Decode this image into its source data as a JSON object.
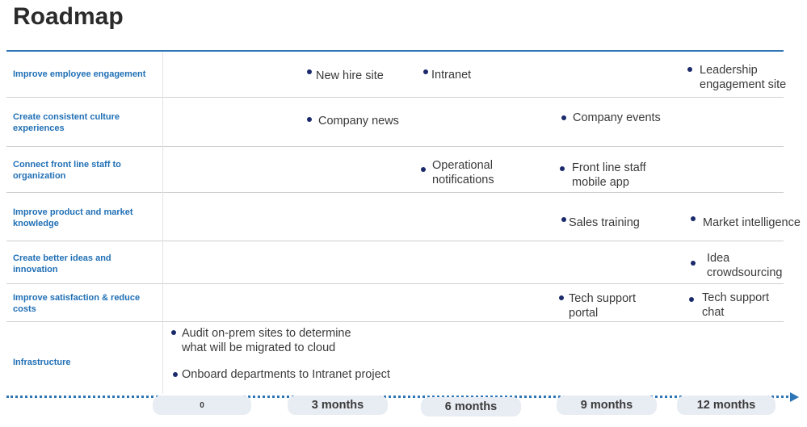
{
  "title": "Roadmap",
  "rows": [
    {
      "label": "Improve employee engagement"
    },
    {
      "label": "Create consistent culture experiences"
    },
    {
      "label": "Connect front line staff to organization"
    },
    {
      "label": "Improve product and market knowledge"
    },
    {
      "label": "Create better ideas and innovation"
    },
    {
      "label": "Improve satisfaction & reduce costs"
    },
    {
      "label": "Infrastructure"
    }
  ],
  "items": {
    "new_hire_site": "New hire site",
    "intranet": "Intranet",
    "leadership_site": "Leadership engagement site",
    "company_news": "Company news",
    "company_events": "Company events",
    "operational_notifications": "Operational notifications",
    "front_line_app": "Front line staff mobile app",
    "sales_training": "Sales training",
    "market_intelligence": "Market intelligence",
    "idea_crowdsourcing": "Idea crowdsourcing",
    "tech_support_portal": "Tech support portal",
    "tech_support_chat": "Tech support chat",
    "audit_sites": "Audit on-prem sites to determine what will be migrated to cloud",
    "onboard_departments": "Onboard departments to Intranet project"
  },
  "timeline": [
    "0",
    "3 months",
    "6 months",
    "9 months",
    "12 months"
  ],
  "colors": {
    "accent": "#2e75b6",
    "label": "#1f6fb5",
    "bullet": "#1b2a6b"
  }
}
